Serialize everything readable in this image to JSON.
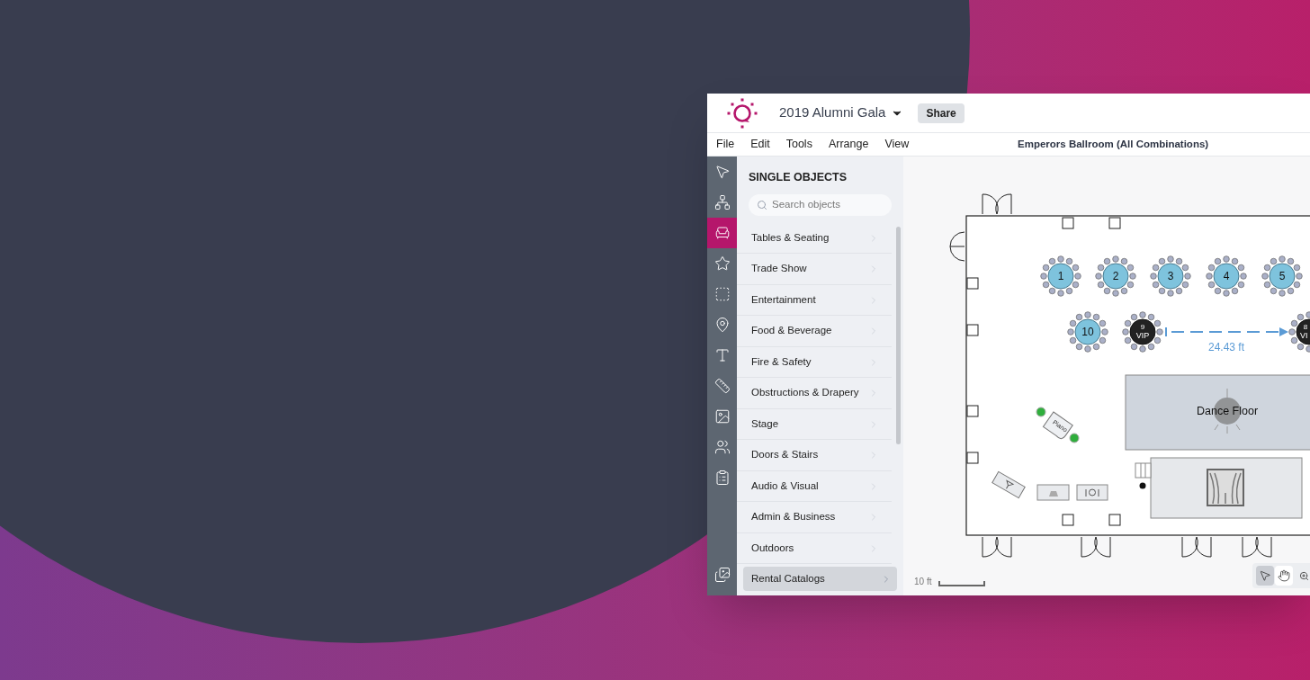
{
  "header": {
    "title": "2019 Alumni Gala",
    "share": "Share"
  },
  "menu": [
    "File",
    "Edit",
    "Tools",
    "Arrange",
    "View"
  ],
  "layout_name": "Emperors Ballroom (All Combinations)",
  "tool_rail": [
    {
      "kind": "pointer",
      "selected": false
    },
    {
      "kind": "network",
      "selected": false
    },
    {
      "kind": "chair",
      "selected": true
    },
    {
      "kind": "star",
      "selected": false
    },
    {
      "kind": "group",
      "selected": false
    },
    {
      "kind": "pin",
      "selected": false
    },
    {
      "kind": "text",
      "selected": false
    },
    {
      "kind": "ruler",
      "selected": false
    },
    {
      "kind": "image",
      "selected": false
    },
    {
      "kind": "people",
      "selected": false
    },
    {
      "kind": "clipboard",
      "selected": false
    },
    {
      "kind": "gallery",
      "selected": false
    }
  ],
  "panel": {
    "title": "SINGLE OBJECTS",
    "search": {
      "placeholder": "Search objects"
    },
    "categories": [
      "Tables & Seating",
      "Trade Show",
      "Entertainment",
      "Food & Beverage",
      "Fire & Safety",
      "Obstructions & Drapery",
      "Stage",
      "Doors & Stairs",
      "Audio & Visual",
      "Admin & Business",
      "Outdoors"
    ],
    "rental": "Rental Catalogs"
  },
  "floor_plan": {
    "tables": [
      {
        "number": "1",
        "kind": "standard"
      },
      {
        "number": "2",
        "kind": "standard"
      },
      {
        "number": "3",
        "kind": "standard"
      },
      {
        "number": "4",
        "kind": "standard"
      },
      {
        "number": "5",
        "kind": "standard"
      },
      {
        "number": "10",
        "kind": "standard"
      },
      {
        "number": "9",
        "tag": "VIP",
        "kind": "vip"
      },
      {
        "number": "8",
        "tag": "VI",
        "kind": "vip"
      }
    ],
    "measurement": "24.43 ft",
    "dance_floor": "Dance Floor",
    "piano": "Piano",
    "scale": "10 ft"
  },
  "view_tools": [
    {
      "kind": "select",
      "selected": true
    },
    {
      "kind": "pan",
      "selected": false
    }
  ]
}
